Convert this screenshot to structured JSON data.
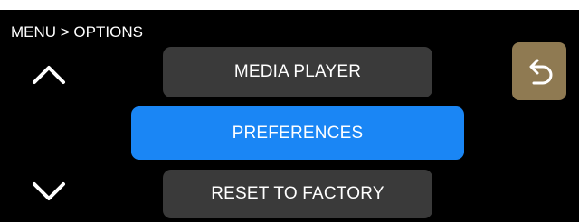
{
  "breadcrumb": "MENU > OPTIONS",
  "menu": {
    "items": [
      {
        "label": "MEDIA PLAYER",
        "selected": false
      },
      {
        "label": "PREFERENCES",
        "selected": true
      },
      {
        "label": "RESET TO FACTORY",
        "selected": false
      }
    ]
  },
  "icons": {
    "scroll_up": "chevron-up-icon",
    "scroll_down": "chevron-down-icon",
    "back": "back-arrow-icon"
  },
  "colors": {
    "screen_background": "#000000",
    "item_background": "#3a3a3a",
    "selected_background": "#1a86f5",
    "back_button": "#8f7a52",
    "text": "#ffffff"
  }
}
